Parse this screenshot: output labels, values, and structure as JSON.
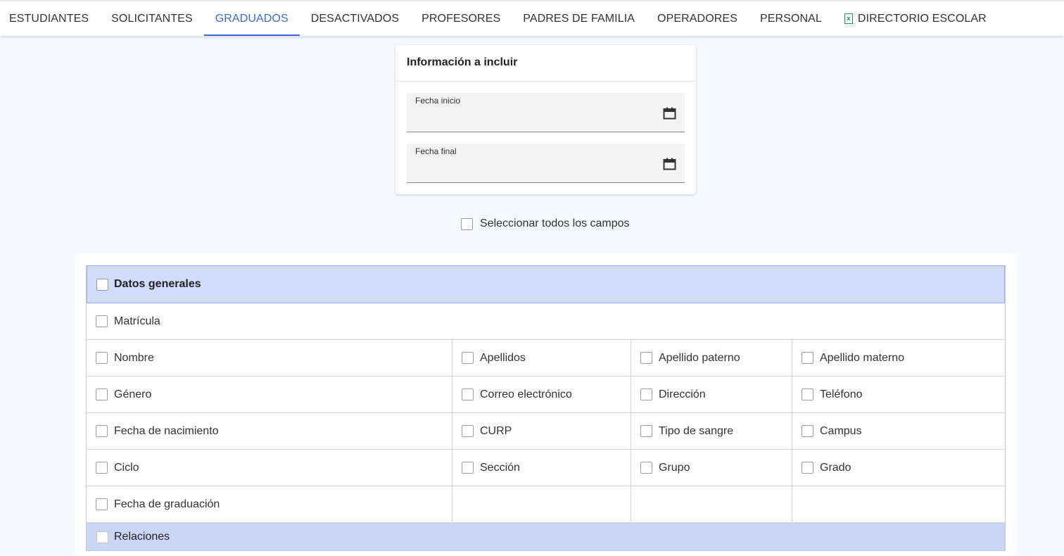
{
  "tabs": [
    {
      "label": "ESTUDIANTES",
      "active": false
    },
    {
      "label": "SOLICITANTES",
      "active": false
    },
    {
      "label": "GRADUADOS",
      "active": true
    },
    {
      "label": "DESACTIVADOS",
      "active": false
    },
    {
      "label": "PROFESORES",
      "active": false
    },
    {
      "label": "PADRES DE FAMILIA",
      "active": false
    },
    {
      "label": "OPERADORES",
      "active": false
    },
    {
      "label": "PERSONAL",
      "active": false
    },
    {
      "label": "DIRECTORIO ESCOLAR",
      "active": false,
      "icon": "excel-file-icon"
    }
  ],
  "colors": {
    "accent": "#3b6ad6",
    "section_header": "#d1dcfc",
    "excel_green": "#1f8f4e"
  },
  "card": {
    "title": "Información a incluir",
    "start_date_label": "Fecha inicio",
    "start_date_value": "",
    "end_date_label": "Fecha final",
    "end_date_value": ""
  },
  "select_all_label": "Seleccionar todos los campos",
  "sections": {
    "general": {
      "title": "Datos generales",
      "matricula": "Matrícula",
      "rows": [
        [
          "Nombre",
          "Apellidos",
          "Apellido paterno",
          "Apellido materno"
        ],
        [
          "Género",
          "Correo electrónico",
          "Dirección",
          "Teléfono"
        ],
        [
          "Fecha de nacimiento",
          "CURP",
          "Tipo de sangre",
          "Campus"
        ],
        [
          "Ciclo",
          "Sección",
          "Grupo",
          "Grado"
        ],
        [
          "Fecha de graduación",
          "",
          "",
          ""
        ]
      ]
    },
    "relations": {
      "title": "Relaciones"
    }
  }
}
